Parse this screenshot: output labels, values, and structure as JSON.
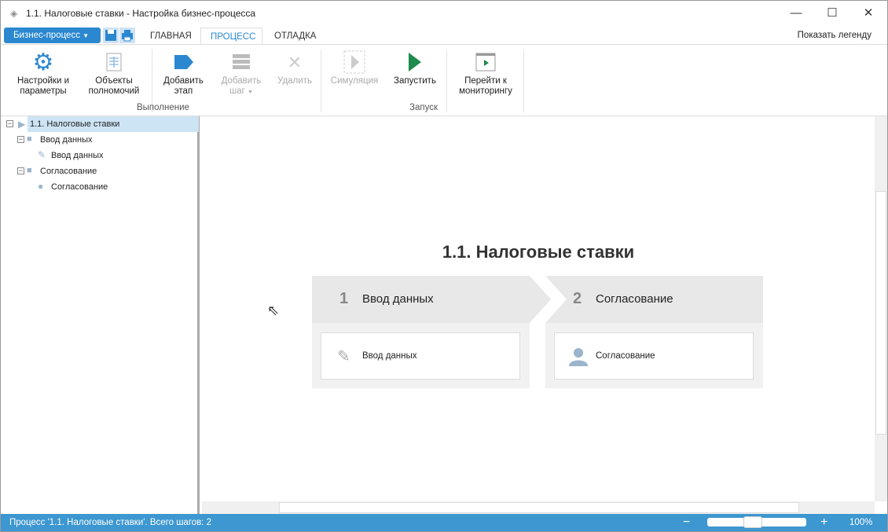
{
  "window": {
    "title": "1.1. Налоговые ставки - Настройка бизнес-процесса"
  },
  "ribbon_tabs": {
    "app_menu": "Бизнес-процесс",
    "tabs": [
      "ГЛАВНАЯ",
      "ПРОЦЕСС",
      "ОТЛАДКА"
    ],
    "legend": "Показать легенду"
  },
  "ribbon": {
    "settings": [
      "Настройки и",
      "параметры"
    ],
    "objects": [
      "Объекты",
      "полномочий"
    ],
    "add_stage": [
      "Добавить",
      "этап"
    ],
    "add_step": [
      "Добавить",
      "шаг"
    ],
    "delete": "Удалить",
    "group_exec": "Выполнение",
    "simulate": "Симуляция",
    "run": "Запустить",
    "monitor": [
      "Перейти к",
      "мониторингу"
    ],
    "group_run": "Запуск"
  },
  "tree": {
    "root": "1.1. Налоговые ставки",
    "items": [
      {
        "stage": "Ввод данных",
        "step": "Ввод данных"
      },
      {
        "stage": "Согласование",
        "step": "Согласование"
      }
    ]
  },
  "diagram": {
    "title": "1.1. Налоговые ставки",
    "stages": [
      {
        "num": "1",
        "label": "Ввод данных",
        "step": "Ввод данных"
      },
      {
        "num": "2",
        "label": "Согласование",
        "step": "Согласование"
      }
    ]
  },
  "status": {
    "text": "Процесс '1.1. Налоговые ставки'. Всего шагов: 2",
    "zoom": "100%",
    "zoom_fraction": 0.45
  },
  "colors": {
    "accent": "#2b88d0",
    "run": "#1e8a4c",
    "status": "#3d97d0"
  }
}
